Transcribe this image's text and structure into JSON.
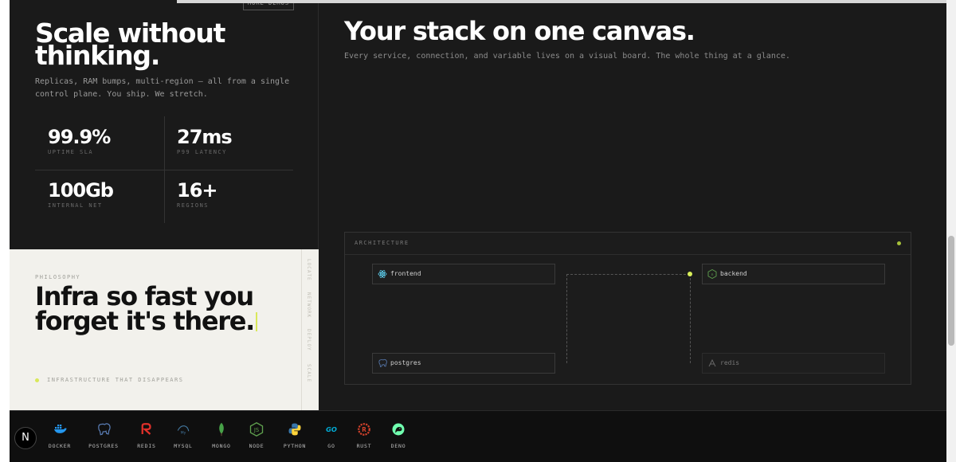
{
  "top_button": "MORE DEMOS",
  "scale": {
    "title": "Scale without thinking.",
    "description": "Replicas, RAM bumps, multi-region — all from a single control plane. You ship. We stretch."
  },
  "stats": [
    {
      "value": "99.9%",
      "label": "UPTIME SLA"
    },
    {
      "value": "27ms",
      "label": "P99 LATENCY"
    },
    {
      "value": "100Gb",
      "label": "INTERNAL NET"
    },
    {
      "value": "16+",
      "label": "REGIONS"
    }
  ],
  "philosophy": {
    "label": "PHILOSOPHY",
    "title": "Infra so fast you forget it's there.",
    "tag": "INFRASTRUCTURE THAT DISAPPEARS",
    "rail": [
      "LOCATE",
      "NETWORK",
      "DEPLOY",
      "SCALE"
    ]
  },
  "canvas": {
    "title": "Your stack on one canvas.",
    "description": "Every service, connection, and variable lives on a visual board. The whole thing at a glance."
  },
  "architecture": {
    "label": "ARCHITECTURE",
    "nodes": [
      {
        "label": "frontend",
        "icon": "react-icon"
      },
      {
        "label": "backend",
        "icon": "node-icon"
      },
      {
        "label": "postgres",
        "icon": "postgres-icon"
      },
      {
        "label": "redis",
        "icon": "redis-icon"
      }
    ]
  },
  "tech": [
    {
      "label": "DOCKER",
      "icon": "docker-icon",
      "color": "#2496ed"
    },
    {
      "label": "POSTGRES",
      "icon": "postgres-icon",
      "color": "#5b7fb8"
    },
    {
      "label": "REDIS",
      "icon": "redis-icon",
      "color": "#e0302a"
    },
    {
      "label": "MYSQL",
      "icon": "mysql-icon",
      "color": "#4479a1"
    },
    {
      "label": "MONGO",
      "icon": "mongo-icon",
      "color": "#47a248"
    },
    {
      "label": "NODE",
      "icon": "node-icon",
      "color": "#5fa04e"
    },
    {
      "label": "PYTHON",
      "icon": "python-icon",
      "color": "#3776ab"
    },
    {
      "label": "GO",
      "icon": "go-icon",
      "color": "#00add8"
    },
    {
      "label": "RUST",
      "icon": "rust-icon",
      "color": "#ce412b"
    },
    {
      "label": "DENO",
      "icon": "deno-icon",
      "color": "#70ffaf"
    }
  ],
  "badge": "N"
}
